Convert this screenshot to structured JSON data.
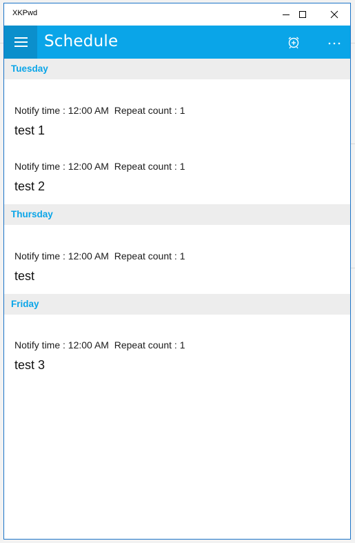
{
  "window": {
    "title": "XKPwd",
    "minimize_icon": "minimize-icon",
    "maximize_icon": "maximize-icon",
    "close_icon": "close-icon"
  },
  "appbar": {
    "title": "Schedule",
    "menu_icon": "hamburger-icon",
    "add_alarm_icon": "alarm-add-icon",
    "more_icon": "more-icon",
    "accent_color": "#0aa5e8"
  },
  "schedule": {
    "groups": [
      {
        "day": "Tuesday",
        "items": [
          {
            "notify_label": "Notify time :",
            "notify_time": "12:00 AM",
            "repeat_label": "Repeat count :",
            "repeat_count": "1",
            "title": "test 1"
          },
          {
            "notify_label": "Notify time :",
            "notify_time": "12:00 AM",
            "repeat_label": "Repeat count :",
            "repeat_count": "1",
            "title": "test 2"
          }
        ]
      },
      {
        "day": "Thursday",
        "items": [
          {
            "notify_label": "Notify time :",
            "notify_time": "12:00 AM",
            "repeat_label": "Repeat count :",
            "repeat_count": "1",
            "title": "test"
          }
        ]
      },
      {
        "day": "Friday",
        "items": [
          {
            "notify_label": "Notify time :",
            "notify_time": "12:00 AM",
            "repeat_label": "Repeat count :",
            "repeat_count": "1",
            "title": "test 3"
          }
        ]
      }
    ]
  }
}
